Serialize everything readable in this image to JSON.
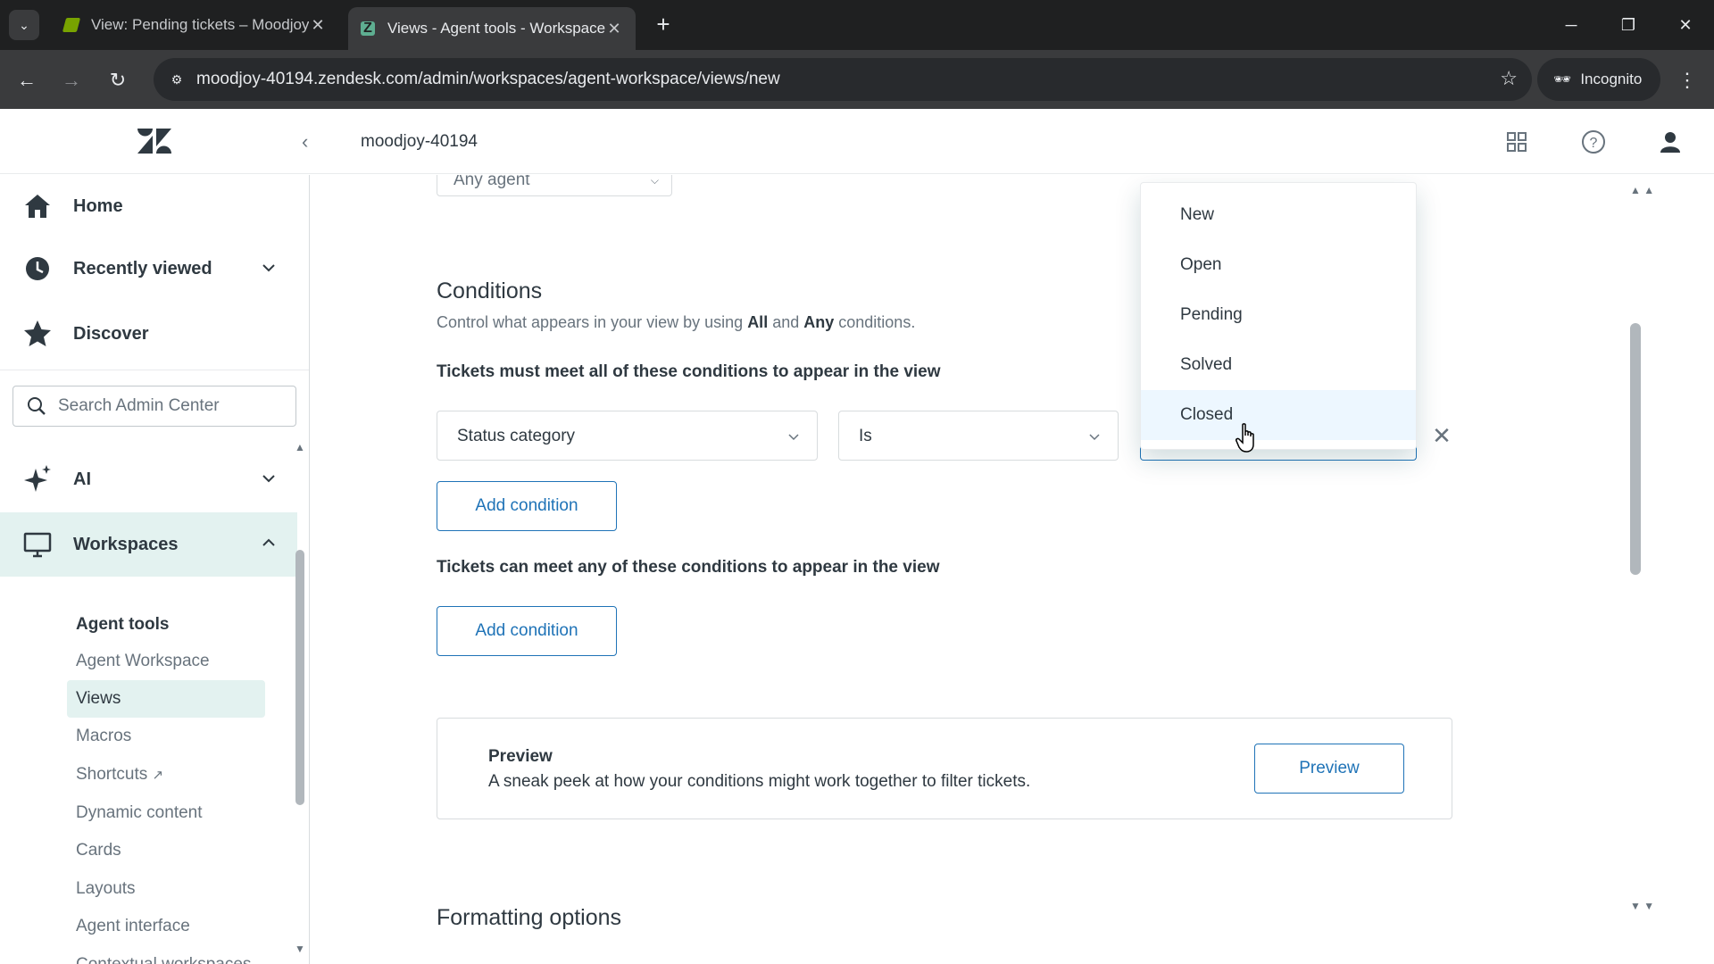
{
  "browser": {
    "tabs": [
      {
        "title": "View: Pending tickets – Moodjoy",
        "active": false
      },
      {
        "title": "Views - Agent tools - Workspaces",
        "active": true
      }
    ],
    "url": "moodjoy-40194.zendesk.com/admin/workspaces/agent-workspace/views/new",
    "incognito_label": "Incognito"
  },
  "header": {
    "account": "moodjoy-40194"
  },
  "sidebar": {
    "nav": [
      {
        "label": "Home",
        "icon": "home-icon"
      },
      {
        "label": "Recently viewed",
        "icon": "clock-icon"
      },
      {
        "label": "Discover",
        "icon": "star-icon"
      }
    ],
    "search_placeholder": "Search Admin Center",
    "sections": [
      {
        "label": "AI",
        "icon": "sparkle-icon"
      },
      {
        "label": "Workspaces",
        "icon": "monitor-icon"
      }
    ],
    "subheading": "Agent tools",
    "subitems": [
      "Agent Workspace",
      "Views",
      "Macros",
      "Shortcuts",
      "Dynamic content",
      "Cards",
      "Layouts",
      "Agent interface",
      "Contextual workspaces"
    ],
    "active_subitem": "Views"
  },
  "form": {
    "any_agent": "Any agent",
    "conditions_title": "Conditions",
    "conditions_desc_pre": "Control what appears in your view by using ",
    "conditions_desc_all": "All",
    "conditions_desc_mid": " and ",
    "conditions_desc_any": "Any",
    "conditions_desc_post": " conditions.",
    "all_label": "Tickets must meet all of these conditions to appear in the view",
    "field_select": "Status category",
    "operator_select": "Is",
    "add_condition": "Add condition",
    "any_label": "Tickets can meet any of these conditions to appear in the view",
    "preview_title": "Preview",
    "preview_desc": "A sneak peek at how your conditions might work together to filter tickets.",
    "preview_button": "Preview",
    "formatting_title": "Formatting options"
  },
  "dropdown": {
    "options": [
      "New",
      "Open",
      "Pending",
      "Solved",
      "Closed"
    ],
    "hovered": "Closed"
  },
  "colors": {
    "accent": "#1f73b7",
    "active_bg": "#e3f2f0",
    "text": "#2f3941",
    "muted": "#68737d"
  }
}
